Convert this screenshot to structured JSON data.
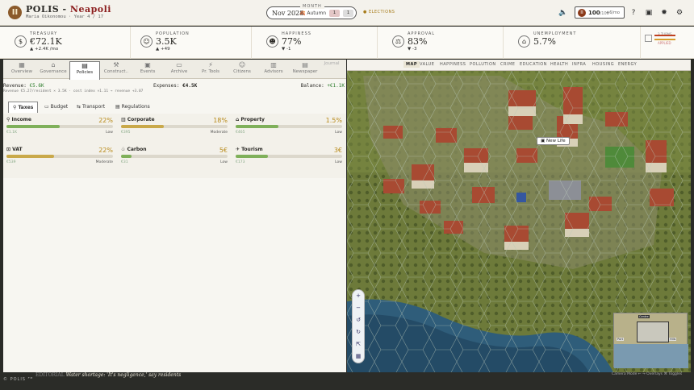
{
  "header": {
    "logo": "II",
    "game": "POLIS -",
    "city": "Neapoli",
    "mayor": "Maria Oikonomou",
    "year": "Year 4 / 17",
    "month_label": "MONTH",
    "date": "Nov 2028",
    "season": "Autumn",
    "pace_a": "1",
    "pace_b": "1",
    "elections": "ELECTIONS",
    "coins": "100",
    "coin_suffix": "/100",
    "coin_rate": "+6/mo"
  },
  "stats": [
    {
      "label": "TREASURY",
      "value": "€72.1K",
      "delta": "▲ +2.4K /mo",
      "icon": "coins-icon"
    },
    {
      "label": "POPULATION",
      "value": "3.5K",
      "delta": "▲ +49",
      "icon": "people-icon"
    },
    {
      "label": "HAPPINESS",
      "value": "77%",
      "delta": "▼ -1",
      "icon": "smile-icon"
    },
    {
      "label": "APPROVAL",
      "value": "83%",
      "delta": "▼ -3",
      "icon": "gavel-icon"
    },
    {
      "label": "UNEMPLOYMENT",
      "value": "5.7%",
      "delta": "",
      "icon": "factory-icon"
    }
  ],
  "rside": {
    "t1": "3 TURNS",
    "t2": "APPLIED"
  },
  "nav": [
    "Overview",
    "Governance",
    "Policies",
    "Construct..",
    "Events",
    "Archive",
    "Pr. Tools",
    "Citizens",
    "Advisors",
    "Newspaper",
    "Journal"
  ],
  "budget": {
    "revenue_label": "Revenue:",
    "revenue": "€5.6K",
    "expenses_label": "Expenses:",
    "expenses": "€4.5K",
    "balance_label": "Balance:",
    "balance": "+€1.1K",
    "detail": "Revenue €5.27/resident × 3.5K · cost index ×1.11 → revenue +3.07"
  },
  "subtabs": [
    "Taxes",
    "Budget",
    "Transport",
    "Regulations"
  ],
  "taxes": [
    {
      "name": "Income",
      "pct": "22%",
      "fill": 0.5,
      "color": "#7fb05a",
      "revenue": "€1.1K",
      "level": "Low"
    },
    {
      "name": "Corporate",
      "pct": "18%",
      "fill": 0.4,
      "color": "#c9a94a",
      "revenue": "€395",
      "level": "Moderate"
    },
    {
      "name": "Property",
      "pct": "1.5%",
      "fill": 0.4,
      "color": "#7fb05a",
      "revenue": "€465",
      "level": "Low"
    },
    {
      "name": "VAT",
      "pct": "22%",
      "fill": 0.45,
      "color": "#c9a94a",
      "revenue": "€539",
      "level": "Moderate"
    },
    {
      "name": "Carbon",
      "pct": "5€",
      "fill": 0.1,
      "color": "#7fb05a",
      "revenue": "€31",
      "level": "Low"
    },
    {
      "name": "Tourism",
      "pct": "3€",
      "fill": 0.3,
      "color": "#7fb05a",
      "revenue": "€173",
      "level": "Low"
    }
  ],
  "maptabs": [
    "MAP",
    "VALUE",
    "HAPPINESS",
    "POLLUTION",
    "CRIME",
    "EDUCATION",
    "HEALTH",
    "INFRA",
    "HOUSING",
    "ENERGY"
  ],
  "map": {
    "newlife": "New Life",
    "minimap_l1": "Centre",
    "minimap_l2": "Port",
    "minimap_l3": "Hills"
  },
  "footer": {
    "brand": "© POLIS ᴾᴹ",
    "news_tag": "EDITORIAL",
    "news": "Water shortage: 'It's negligence,' say residents",
    "keys": "Camera  Mode  ←  →  Overlays  ⌘  Toggles"
  }
}
